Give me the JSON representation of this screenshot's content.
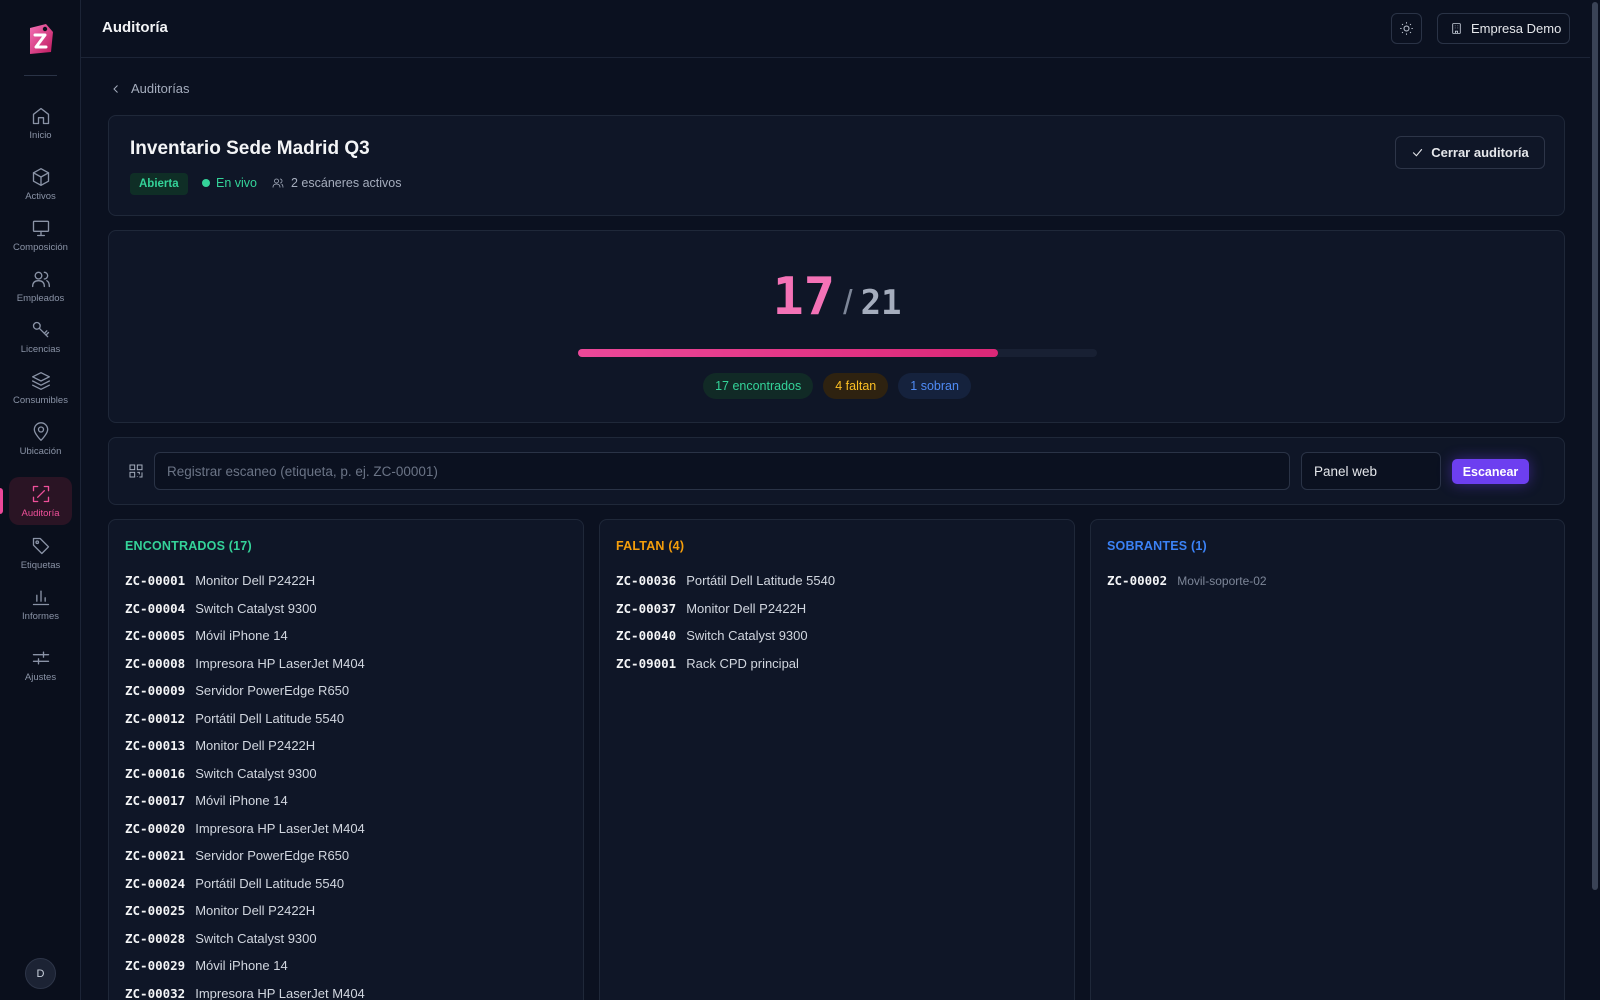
{
  "sidebar": {
    "items": [
      {
        "label": "Inicio",
        "icon": "home-icon"
      },
      {
        "label": "Activos",
        "icon": "box-icon"
      },
      {
        "label": "Composición",
        "icon": "monitor-icon"
      },
      {
        "label": "Empleados",
        "icon": "users-icon"
      },
      {
        "label": "Licencias",
        "icon": "key-icon"
      },
      {
        "label": "Consumibles",
        "icon": "layers-icon"
      },
      {
        "label": "Ubicación",
        "icon": "map-pin-icon"
      },
      {
        "label": "Auditoría",
        "icon": "scan-icon"
      },
      {
        "label": "Etiquetas",
        "icon": "tag-icon"
      },
      {
        "label": "Informes",
        "icon": "bar-chart-icon"
      },
      {
        "label": "Ajustes",
        "icon": "sliders-icon"
      }
    ],
    "active_index": 7,
    "user_initial": "D"
  },
  "header": {
    "title": "Auditoría",
    "company": "Empresa Demo"
  },
  "breadcrumb": {
    "back_label": "Auditorías"
  },
  "audit": {
    "title": "Inventario Sede Madrid Q3",
    "status": "Abierta",
    "live": "En vivo",
    "scanners": "2 escáneres activos",
    "close_label": "Cerrar auditoría"
  },
  "progress": {
    "found": "17",
    "separator": "/",
    "total": "21",
    "fraction": 0.81,
    "pills": {
      "found": "17 encontrados",
      "missing": "4 faltan",
      "extra": "1 sobran"
    }
  },
  "scan": {
    "placeholder": "Registrar escaneo (etiqueta, p. ej. ZC-00001)",
    "source": "Panel web",
    "button": "Escanear"
  },
  "columns": {
    "found": {
      "title": "ENCONTRADOS (17)",
      "items": [
        {
          "code": "ZC-00001",
          "name": "Monitor Dell P2422H"
        },
        {
          "code": "ZC-00004",
          "name": "Switch Catalyst 9300"
        },
        {
          "code": "ZC-00005",
          "name": "Móvil iPhone 14"
        },
        {
          "code": "ZC-00008",
          "name": "Impresora HP LaserJet M404"
        },
        {
          "code": "ZC-00009",
          "name": "Servidor PowerEdge R650"
        },
        {
          "code": "ZC-00012",
          "name": "Portátil Dell Latitude 5540"
        },
        {
          "code": "ZC-00013",
          "name": "Monitor Dell P2422H"
        },
        {
          "code": "ZC-00016",
          "name": "Switch Catalyst 9300"
        },
        {
          "code": "ZC-00017",
          "name": "Móvil iPhone 14"
        },
        {
          "code": "ZC-00020",
          "name": "Impresora HP LaserJet M404"
        },
        {
          "code": "ZC-00021",
          "name": "Servidor PowerEdge R650"
        },
        {
          "code": "ZC-00024",
          "name": "Portátil Dell Latitude 5540"
        },
        {
          "code": "ZC-00025",
          "name": "Monitor Dell P2422H"
        },
        {
          "code": "ZC-00028",
          "name": "Switch Catalyst 9300"
        },
        {
          "code": "ZC-00029",
          "name": "Móvil iPhone 14"
        },
        {
          "code": "ZC-00032",
          "name": "Impresora HP LaserJet M404"
        }
      ]
    },
    "missing": {
      "title": "FALTAN (4)",
      "items": [
        {
          "code": "ZC-00036",
          "name": "Portátil Dell Latitude 5540"
        },
        {
          "code": "ZC-00037",
          "name": "Monitor Dell P2422H"
        },
        {
          "code": "ZC-00040",
          "name": "Switch Catalyst 9300"
        },
        {
          "code": "ZC-09001",
          "name": "Rack CPD principal"
        }
      ]
    },
    "extra": {
      "title": "SOBRANTES (1)",
      "items": [
        {
          "code": "ZC-00002",
          "name": "Movil-soporte-02"
        }
      ]
    }
  },
  "colors": {
    "accent": "#ec4899",
    "success": "#34d399",
    "warning": "#f59e0b",
    "info": "#3b82f6",
    "primary_button": "#6d3ff0"
  }
}
